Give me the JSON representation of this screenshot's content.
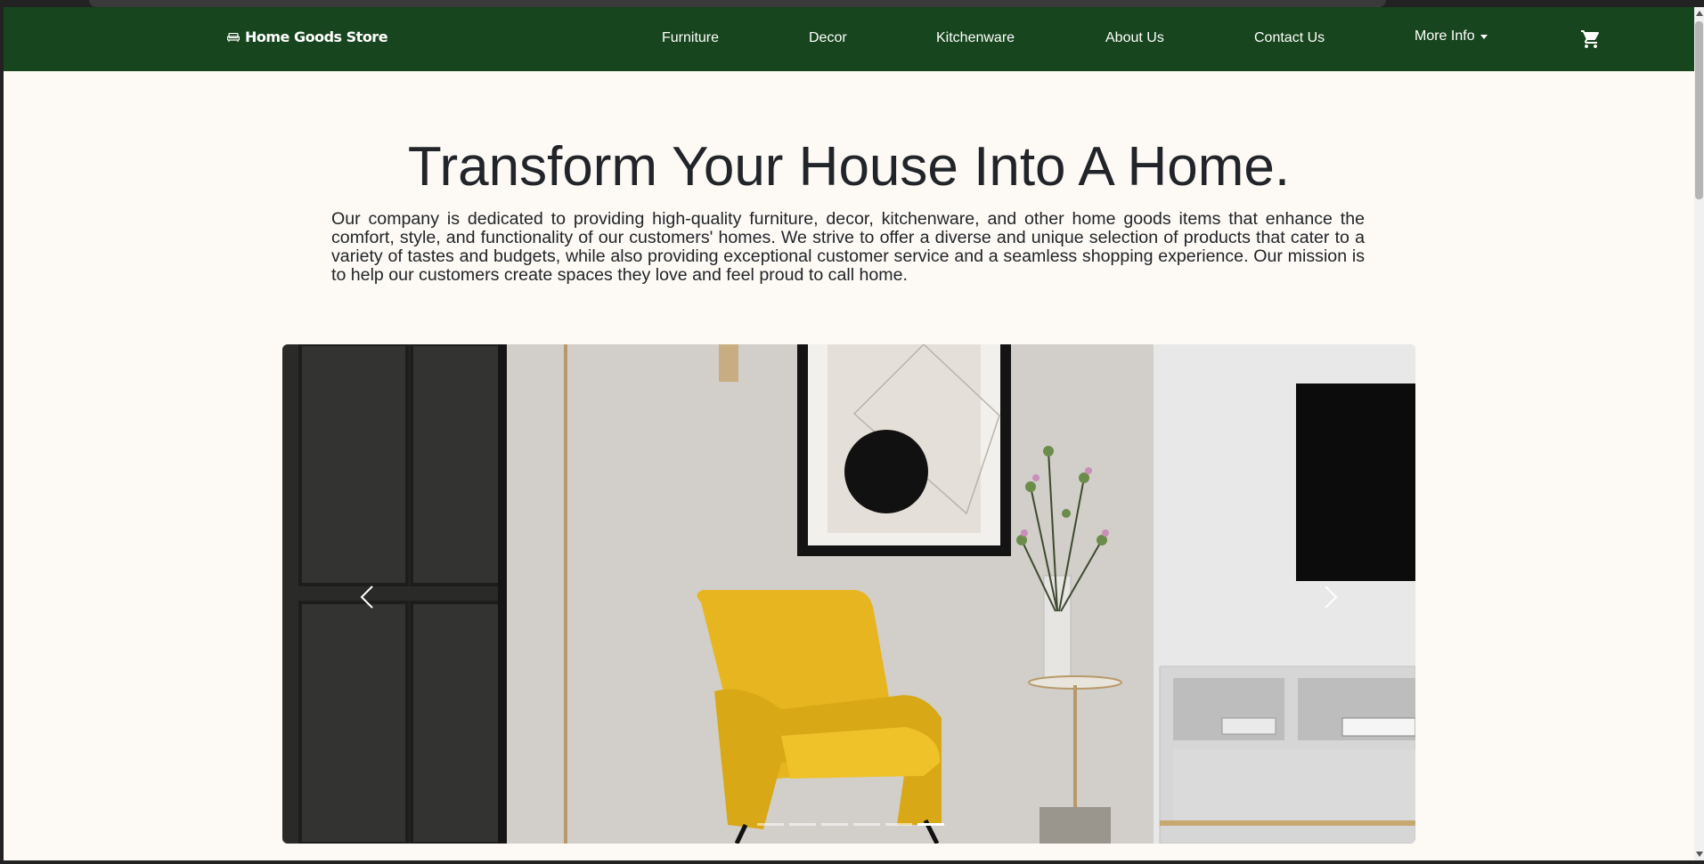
{
  "brand": {
    "name": "Home Goods Store",
    "icon": "sofa-icon"
  },
  "nav": {
    "links": [
      "Furniture",
      "Decor",
      "Kitchenware",
      "About Us",
      "Contact Us"
    ],
    "more_label": "More Info",
    "cart_icon": "cart-icon"
  },
  "hero": {
    "title": "Transform Your House Into A Home.",
    "text": "Our company is dedicated to providing high-quality furniture, decor, kitchenware, and other home goods items that enhance the comfort, style, and functionality of our customers' homes. We strive to offer a diverse and unique selection of products that cater to a variety of tastes and budgets, while also providing exceptional customer service and a seamless shopping experience. Our mission is to help our customers create spaces they love and feel proud to call home."
  },
  "carousel": {
    "slide_count": 6,
    "active_index": 5,
    "prev_icon": "chevron-left-icon",
    "next_icon": "chevron-right-icon"
  },
  "colors": {
    "navbar": "#17451d",
    "page_bg": "#fdf9f5",
    "text": "#212529",
    "accent_chair": "#e6b520"
  }
}
